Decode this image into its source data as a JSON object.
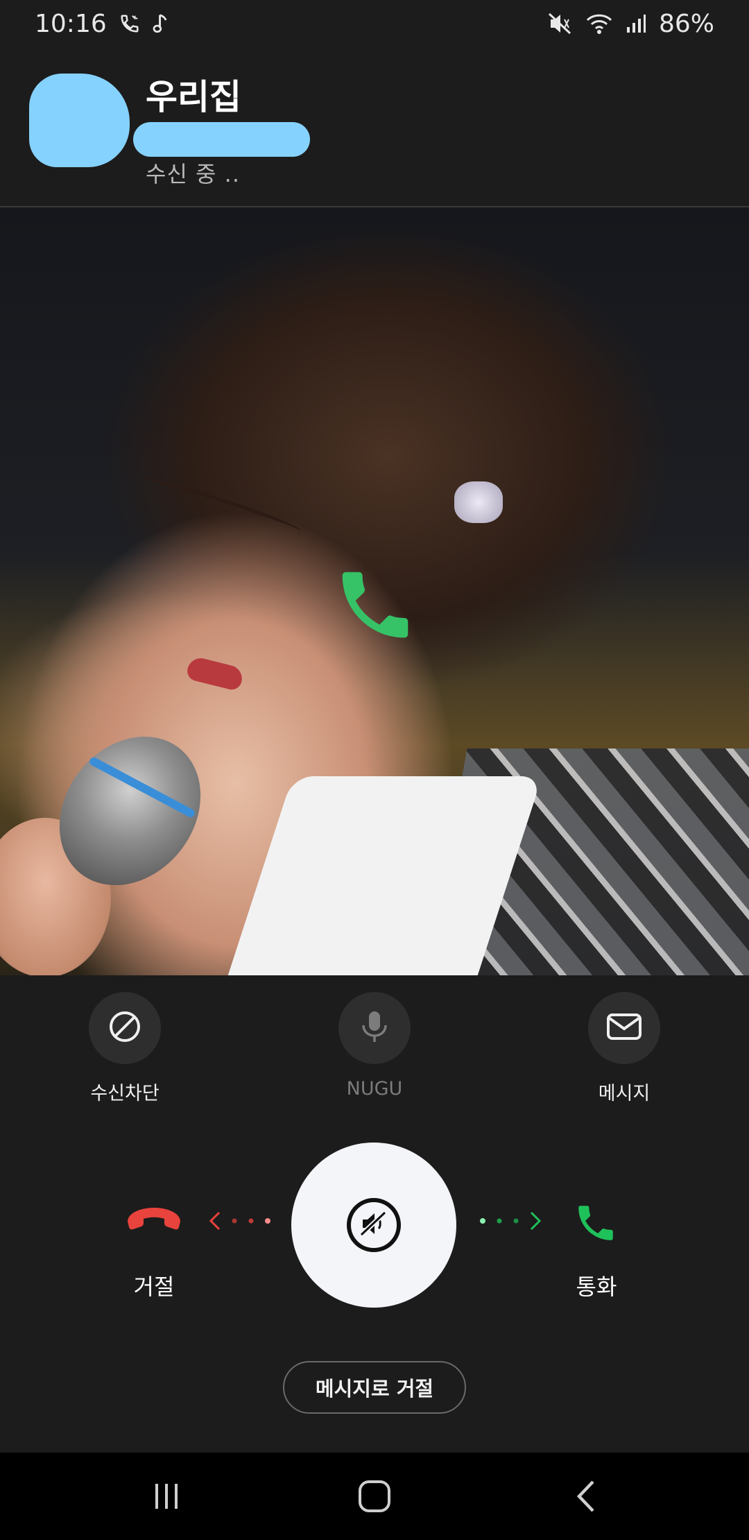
{
  "status_bar": {
    "time": "10:16",
    "battery": "86%",
    "icons": [
      "phone-call-icon",
      "music-note-icon",
      "vibrate-mute-icon",
      "wifi-icon",
      "signal-icon"
    ]
  },
  "caller": {
    "name": "우리집",
    "status": "수신 중 .."
  },
  "actions": [
    {
      "label": "수신차단",
      "icon": "block-icon"
    },
    {
      "label": "NUGU",
      "icon": "microphone-icon"
    },
    {
      "label": "메시지",
      "icon": "envelope-icon"
    }
  ],
  "swipe": {
    "decline_label": "거절",
    "accept_label": "통화",
    "decline_color": "#e8433c",
    "accept_color": "#1fc15a"
  },
  "reject_with_message_label": "메시지로 거절"
}
